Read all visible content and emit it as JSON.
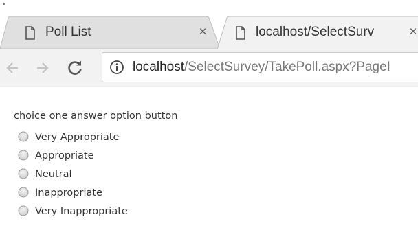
{
  "browser": {
    "tabs": [
      {
        "title": "Poll List",
        "close": "×",
        "active": false
      },
      {
        "title": "localhost/SelectSurv",
        "close": "×",
        "active": true
      }
    ],
    "url_host": "localhost",
    "url_path": "/SelectSurvey/TakePoll.aspx?PageI",
    "icons": {
      "back": "back-arrow-icon",
      "forward": "forward-arrow-icon",
      "reload": "reload-icon",
      "info": "info-icon",
      "page": "document-icon"
    }
  },
  "poll": {
    "question": "choice one answer option button",
    "options": [
      {
        "label": "Very Appropriate",
        "selected": false
      },
      {
        "label": "Appropriate",
        "selected": false
      },
      {
        "label": "Neutral",
        "selected": false
      },
      {
        "label": "Inappropriate",
        "selected": false
      },
      {
        "label": "Very Inappropriate",
        "selected": false
      }
    ]
  }
}
